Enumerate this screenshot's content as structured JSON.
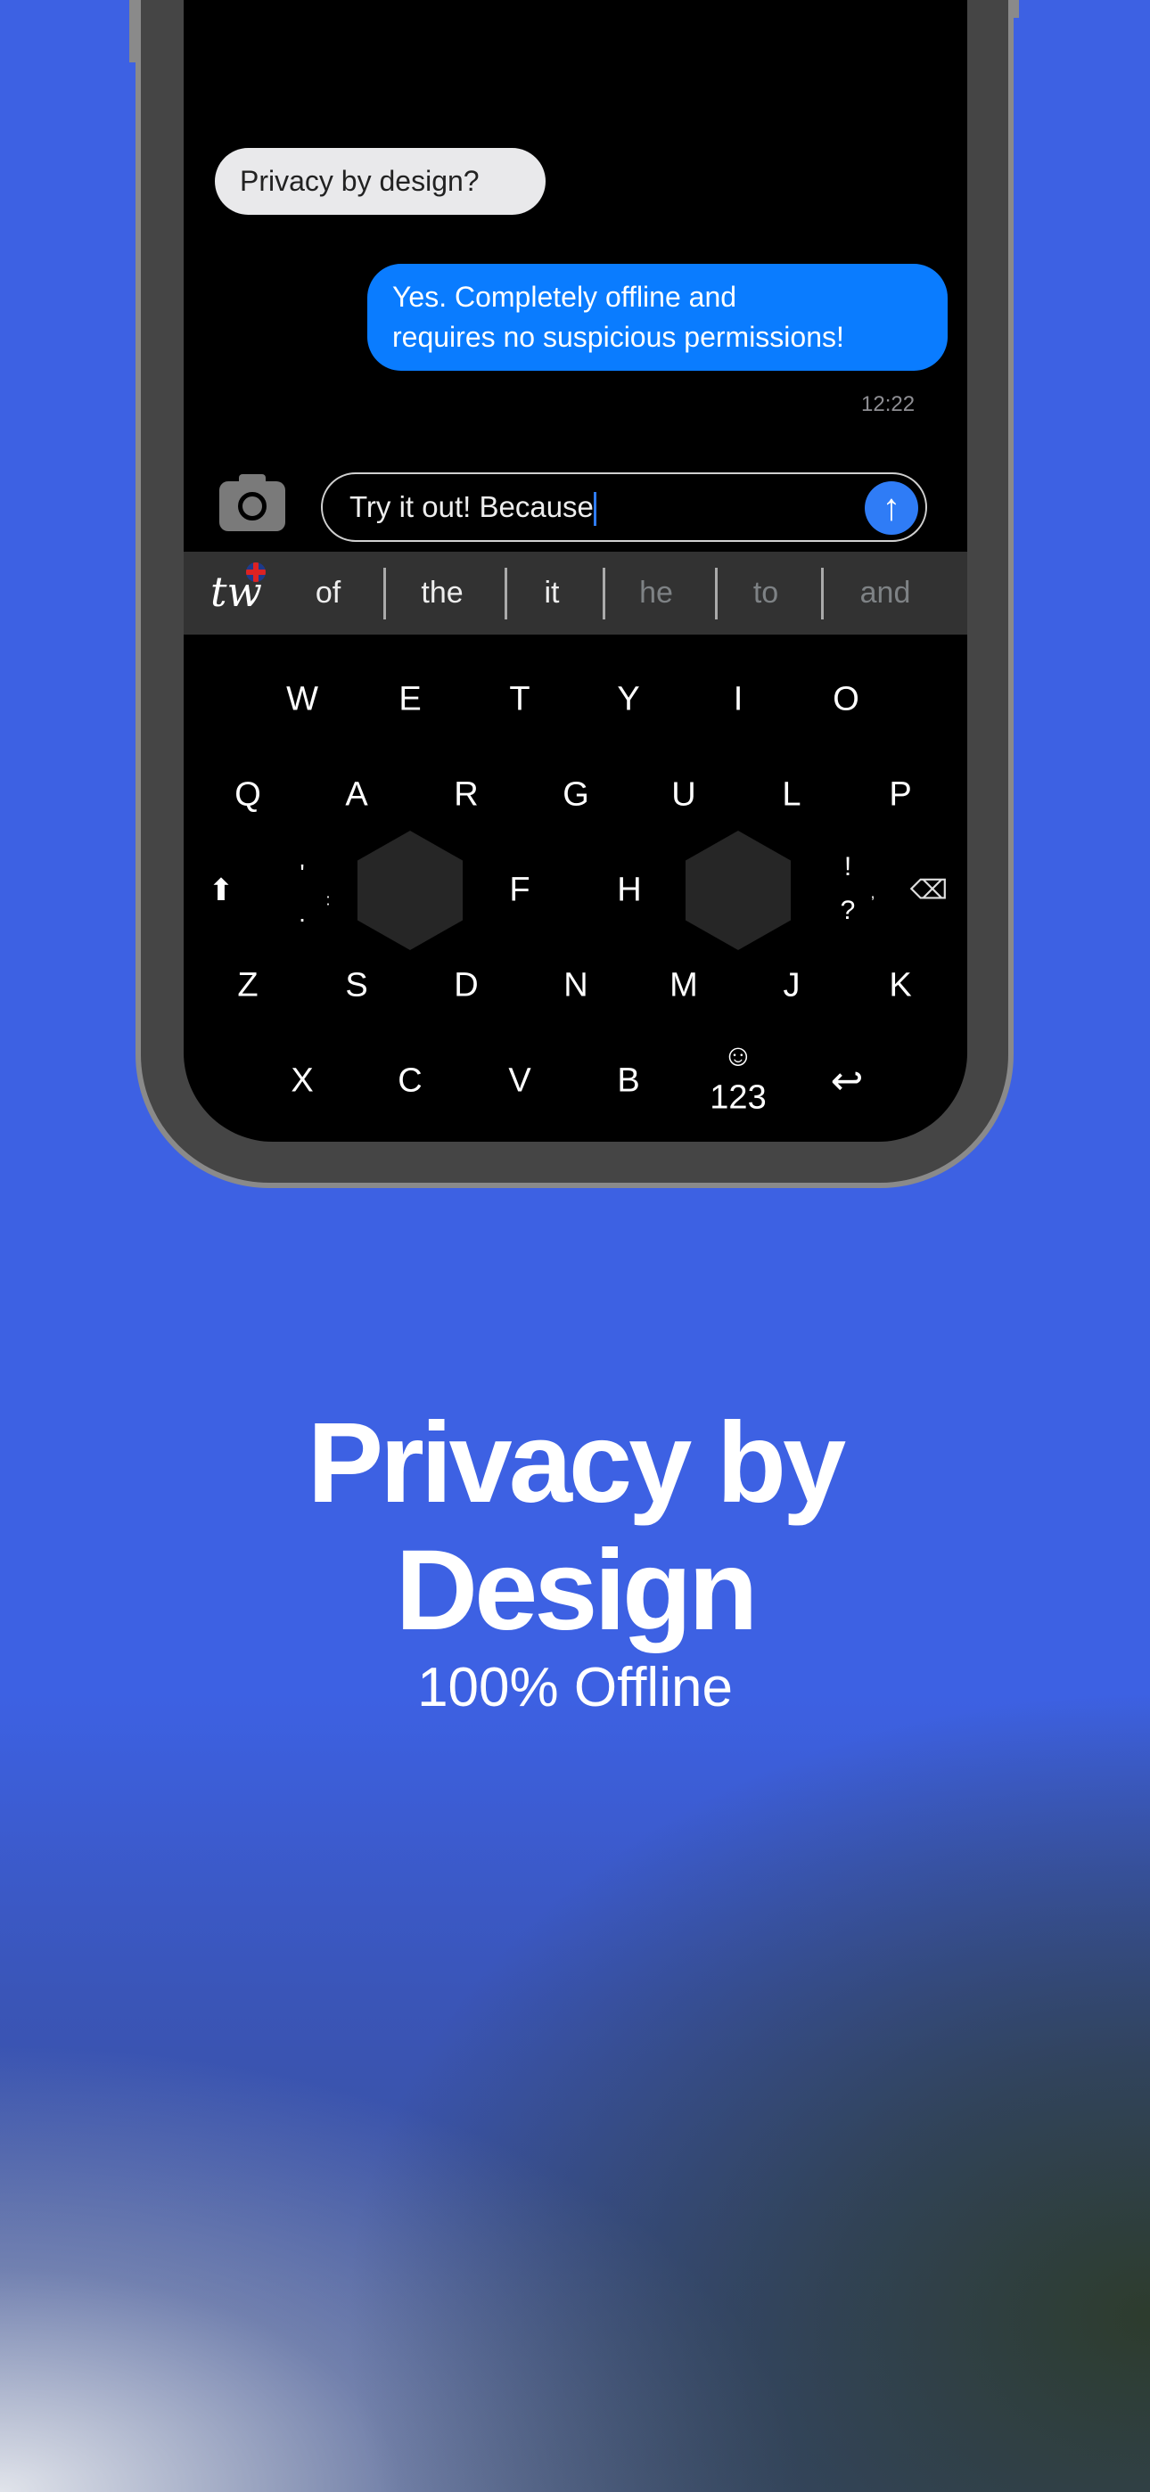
{
  "chat": {
    "incoming": "Privacy by design?",
    "outgoing_line1": "Yes. Completely offline and",
    "outgoing_line2": "requires no suspicious permissions!",
    "time": "12:22"
  },
  "input": {
    "value": "Try it out! Because",
    "send_icon": "arrow-up-icon"
  },
  "suggestions": {
    "logo": "tw",
    "words": [
      "of",
      "the",
      "it",
      "he",
      "to",
      "and"
    ]
  },
  "keyboard": {
    "row1": [
      "W",
      "E",
      "T",
      "Y",
      "I",
      "O"
    ],
    "row2": [
      "Q",
      "A",
      "R",
      "G",
      "U",
      "L",
      "P"
    ],
    "row3": {
      "punct_left_top": "'",
      "punct_left_bottom": ".",
      "punct_left_side": ":",
      "f": "F",
      "h": "H",
      "punct_right_top": "!",
      "punct_right_bottom": "?",
      "punct_right_side": ","
    },
    "row4": [
      "Z",
      "S",
      "D",
      "N",
      "M",
      "J",
      "K"
    ],
    "row5": [
      "X",
      "C",
      "V",
      "B"
    ],
    "numbers": "123"
  },
  "headline": {
    "line1": "Privacy by",
    "line2": "Design",
    "subtitle": "100% Offline"
  },
  "colors": {
    "background": "#3d61e3",
    "accent": "#2f7cf6",
    "outgoing_bubble": "#0a7cff"
  }
}
